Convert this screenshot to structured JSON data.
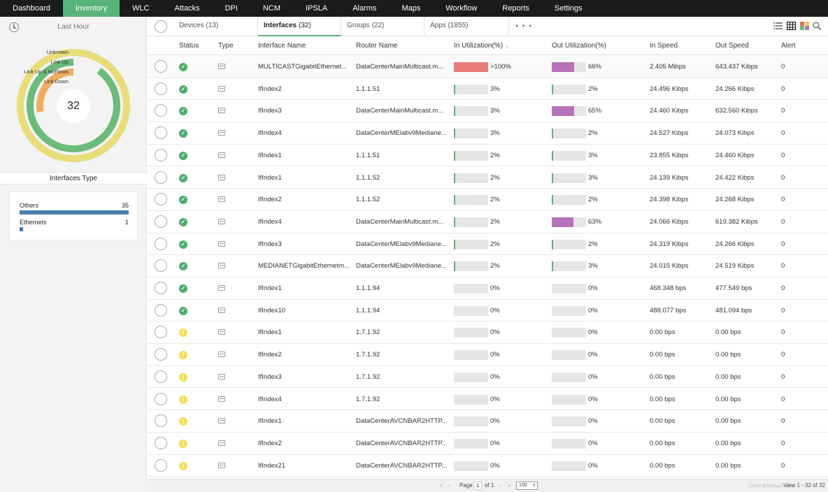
{
  "nav": [
    "Dashboard",
    "Inventory",
    "WLC",
    "Attacks",
    "DPI",
    "NCM",
    "IPSLA",
    "Alarms",
    "Maps",
    "Workflow",
    "Reports",
    "Settings"
  ],
  "nav_active": "Inventory",
  "left": {
    "time_label": "Last Hour",
    "donut": {
      "total": "32",
      "legend": [
        "Unknown",
        "Link Up",
        "Link Up & NoFlows",
        "Link Down"
      ],
      "colors": {
        "unknown": "#e8dd78",
        "link_up": "#6dbb7a",
        "link_up_noflows": "#eeae62",
        "link_down": "#e06060"
      },
      "fill": {
        "unknown": 1.0,
        "link_up": 0.9,
        "link_up_noflows": 0.28
      }
    },
    "types_title": "Interfaces Type",
    "types": [
      {
        "name": "Others",
        "count": "35",
        "fraction": 1.0
      },
      {
        "name": "Ethernets",
        "count": "1",
        "fraction": 0.03
      }
    ]
  },
  "tabs": [
    {
      "label": "Devices",
      "count": "(13)"
    },
    {
      "label": "Interfaces",
      "count": "(32)"
    },
    {
      "label": "Groups",
      "count": "(22)"
    },
    {
      "label": "Apps",
      "count": "(1855)"
    }
  ],
  "tab_more": "• • •",
  "tools": [
    "list-view-icon",
    "grid-view-icon",
    "heatmap-view-icon",
    "search-icon"
  ],
  "columns": [
    "Status",
    "Type",
    "Interface Name",
    "Router Name",
    "In Utilization(%)",
    "Out Utilization(%)",
    "In Speed",
    "Out Speed",
    "Alert"
  ],
  "rows": [
    {
      "status": "ok",
      "iface": "MULTICASTGigabitEthernet...",
      "router": "DataCenterMainMulticast.m...",
      "in_pct": ">100%",
      "in_val": 100,
      "out_pct": "66%",
      "out_val": 66,
      "in_speed": "2.405 Mibps",
      "out_speed": "643.437 Kibps",
      "alert": "0"
    },
    {
      "status": "ok",
      "iface": "IfIndex2",
      "router": "1.1.1.51",
      "in_pct": "3%",
      "in_val": 3,
      "out_pct": "2%",
      "out_val": 2,
      "in_speed": "24.496 Kibps",
      "out_speed": "24.266 Kibps",
      "alert": "0"
    },
    {
      "status": "ok",
      "iface": "IfIndex3",
      "router": "DataCenterMainMulticast.m...",
      "in_pct": "3%",
      "in_val": 3,
      "out_pct": "65%",
      "out_val": 65,
      "in_speed": "24.460 Kibps",
      "out_speed": "632.560 Kibps",
      "alert": "0"
    },
    {
      "status": "ok",
      "iface": "IfIndex4",
      "router": "DataCenterMElabv9Mediane...",
      "in_pct": "3%",
      "in_val": 3,
      "out_pct": "2%",
      "out_val": 2,
      "in_speed": "24.527 Kibps",
      "out_speed": "24.073 Kibps",
      "alert": "0"
    },
    {
      "status": "ok",
      "iface": "IfIndex1",
      "router": "1.1.1.51",
      "in_pct": "2%",
      "in_val": 2,
      "out_pct": "3%",
      "out_val": 3,
      "in_speed": "23.855 Kibps",
      "out_speed": "24.460 Kibps",
      "alert": "0"
    },
    {
      "status": "ok",
      "iface": "IfIndex1",
      "router": "1.1.1.52",
      "in_pct": "2%",
      "in_val": 2,
      "out_pct": "3%",
      "out_val": 3,
      "in_speed": "24.139 Kibps",
      "out_speed": "24.422 Kibps",
      "alert": "0"
    },
    {
      "status": "ok",
      "iface": "IfIndex2",
      "router": "1.1.1.52",
      "in_pct": "2%",
      "in_val": 2,
      "out_pct": "2%",
      "out_val": 2,
      "in_speed": "24.398 Kibps",
      "out_speed": "24.268 Kibps",
      "alert": "0"
    },
    {
      "status": "ok",
      "iface": "IfIndex4",
      "router": "DataCenterMainMulticast.m...",
      "in_pct": "2%",
      "in_val": 2,
      "out_pct": "63%",
      "out_val": 63,
      "in_speed": "24.066 Kibps",
      "out_speed": "619.382 Kibps",
      "alert": "0"
    },
    {
      "status": "ok",
      "iface": "IfIndex3",
      "router": "DataCenterMElabv9Mediane...",
      "in_pct": "2%",
      "in_val": 2,
      "out_pct": "2%",
      "out_val": 2,
      "in_speed": "24.319 Kibps",
      "out_speed": "24.266 Kibps",
      "alert": "0"
    },
    {
      "status": "ok",
      "iface": "MEDIANETGigabitEthernetm...",
      "router": "DataCenterMElabv9Mediane...",
      "in_pct": "2%",
      "in_val": 2,
      "out_pct": "3%",
      "out_val": 3,
      "in_speed": "24.015 Kibps",
      "out_speed": "24.519 Kibps",
      "alert": "0"
    },
    {
      "status": "ok",
      "iface": "IfIndex1",
      "router": "1.1.1.94",
      "in_pct": "0%",
      "in_val": 0,
      "out_pct": "0%",
      "out_val": 0,
      "in_speed": "468.348 bps",
      "out_speed": "477.549 bps",
      "alert": "0"
    },
    {
      "status": "ok",
      "iface": "IfIndex10",
      "router": "1.1.1.94",
      "in_pct": "0%",
      "in_val": 0,
      "out_pct": "0%",
      "out_val": 0,
      "in_speed": "488.077 bps",
      "out_speed": "481.094 bps",
      "alert": "0"
    },
    {
      "status": "warn",
      "iface": "IfIndex1",
      "router": "1.7.1.92",
      "in_pct": "0%",
      "in_val": 0,
      "out_pct": "0%",
      "out_val": 0,
      "in_speed": "0.00 bps",
      "out_speed": "0.00 bps",
      "alert": "0"
    },
    {
      "status": "warn",
      "iface": "IfIndex2",
      "router": "1.7.1.92",
      "in_pct": "0%",
      "in_val": 0,
      "out_pct": "0%",
      "out_val": 0,
      "in_speed": "0.00 bps",
      "out_speed": "0.00 bps",
      "alert": "0"
    },
    {
      "status": "warn",
      "iface": "IfIndex3",
      "router": "1.7.1.92",
      "in_pct": "0%",
      "in_val": 0,
      "out_pct": "0%",
      "out_val": 0,
      "in_speed": "0.00 bps",
      "out_speed": "0.00 bps",
      "alert": "0"
    },
    {
      "status": "warn",
      "iface": "IfIndex4",
      "router": "1.7.1.92",
      "in_pct": "0%",
      "in_val": 0,
      "out_pct": "0%",
      "out_val": 0,
      "in_speed": "0.00 bps",
      "out_speed": "0.00 bps",
      "alert": "0"
    },
    {
      "status": "warn",
      "iface": "IfIndex1",
      "router": "DataCenterAVCNBAR2HTTP...",
      "in_pct": "0%",
      "in_val": 0,
      "out_pct": "0%",
      "out_val": 0,
      "in_speed": "0.00 bps",
      "out_speed": "0.00 bps",
      "alert": "0"
    },
    {
      "status": "warn",
      "iface": "IfIndex2",
      "router": "DataCenterAVCNBAR2HTTP...",
      "in_pct": "0%",
      "in_val": 0,
      "out_pct": "0%",
      "out_val": 0,
      "in_speed": "0.00 bps",
      "out_speed": "0.00 bps",
      "alert": "0"
    },
    {
      "status": "warn",
      "iface": "IfIndex21",
      "router": "DataCenterAVCNBAR2HTTP...",
      "in_pct": "0%",
      "in_val": 0,
      "out_pct": "0%",
      "out_val": 0,
      "in_speed": "0.00 bps",
      "out_speed": "0.00 bps",
      "alert": "0"
    }
  ],
  "colors": {
    "in_high": "#e97b7b",
    "out_fill": "#b672b9",
    "low_tick": "#5ab47a",
    "ok": "#4cae6a",
    "warn": "#f3df57"
  },
  "footer": {
    "page_label": "Page",
    "page": "1",
    "of_label": "of 1",
    "per_page": "100",
    "view_info": "View 1 - 32 of 32",
    "watermark": "CSDN @ManageEngine"
  }
}
